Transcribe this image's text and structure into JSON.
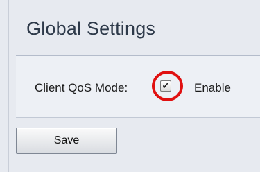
{
  "page": {
    "title": "Global Settings"
  },
  "settings": {
    "client_qos_label": "Client QoS Mode:",
    "enable_label": "Enable",
    "enable_checked": true,
    "check_icon": "checkmark-icon",
    "highlight_color": "#e01010"
  },
  "actions": {
    "save_label": "Save"
  }
}
